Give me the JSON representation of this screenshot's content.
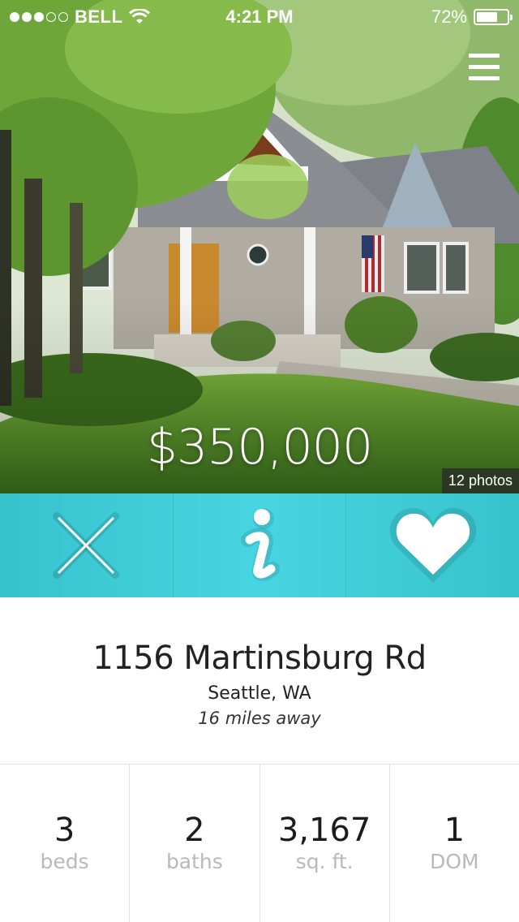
{
  "status_bar": {
    "carrier": "BELL",
    "time": "4:21 PM",
    "battery_text": "72%",
    "battery_level": 0.72,
    "signal_filled": 3,
    "signal_total": 5
  },
  "listing": {
    "price": "$350,000",
    "photo_count": "12 photos",
    "street": "1156 Martinsburg Rd",
    "city": "Seattle, WA",
    "distance": "16 miles away"
  },
  "actions": [
    {
      "name": "dismiss",
      "icon": "close-icon"
    },
    {
      "name": "info",
      "icon": "info-icon"
    },
    {
      "name": "favorite",
      "icon": "heart-icon"
    }
  ],
  "stats": [
    {
      "value": "3",
      "label": "beds"
    },
    {
      "value": "2",
      "label": "baths"
    },
    {
      "value": "3,167",
      "label": "sq. ft."
    },
    {
      "value": "1",
      "label": "DOM"
    }
  ],
  "colors": {
    "accent": "#40cfdb",
    "label_gray": "#b9b9b9",
    "text_dark": "#222222"
  }
}
